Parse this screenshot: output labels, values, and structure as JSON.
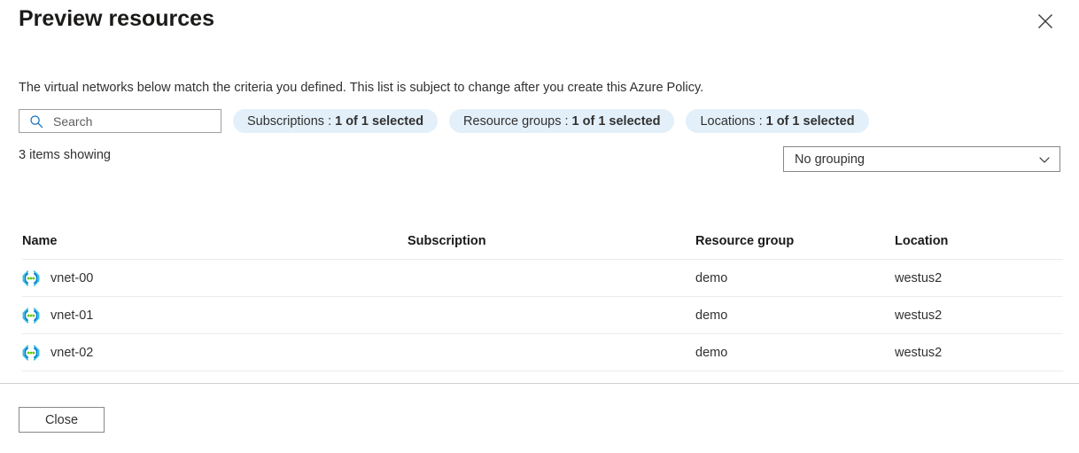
{
  "panel": {
    "title": "Preview resources",
    "close_icon": "close-icon",
    "description": "The virtual networks below match the criteria you defined. This list is subject to change after you create this Azure Policy."
  },
  "filters": {
    "search": {
      "icon": "search-icon",
      "placeholder": "Search",
      "value": ""
    },
    "pills": [
      {
        "label": "Subscriptions :",
        "value": "1 of 1 selected"
      },
      {
        "label": "Resource groups :",
        "value": "1 of 1 selected"
      },
      {
        "label": "Locations :",
        "value": "1 of 1 selected"
      }
    ]
  },
  "toolbar": {
    "items_showing": "3 items showing",
    "grouping": {
      "selected": "No grouping",
      "icon": "chevron-down-icon"
    }
  },
  "table": {
    "columns": [
      "Name",
      "Subscription",
      "Resource group",
      "Location"
    ],
    "rows": [
      {
        "icon": "virtual-network-icon",
        "name": "vnet-00",
        "subscription": "",
        "resource_group": "demo",
        "location": "westus2"
      },
      {
        "icon": "virtual-network-icon",
        "name": "vnet-01",
        "subscription": "",
        "resource_group": "demo",
        "location": "westus2"
      },
      {
        "icon": "virtual-network-icon",
        "name": "vnet-02",
        "subscription": "",
        "resource_group": "demo",
        "location": "westus2"
      }
    ]
  },
  "footer": {
    "close_label": "Close"
  },
  "colors": {
    "accent": "#0078d4",
    "pill_background": "#e3f0fa",
    "icon_cyan": "#32bedd",
    "icon_blue": "#0078d4",
    "icon_green": "#5ec809",
    "text": "#323130"
  }
}
